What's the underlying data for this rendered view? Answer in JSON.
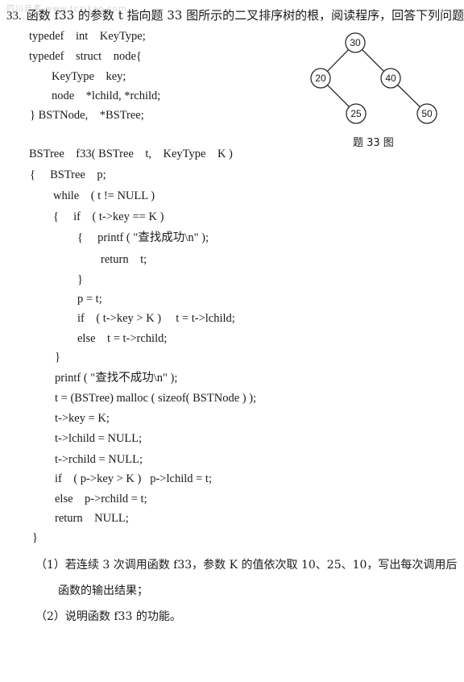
{
  "watermark": "四川自考 www.tczikao.com",
  "question": {
    "number": "33.",
    "prompt": "函数 f33 的参数 t 指向题 33 图所示的二叉排序树的根，阅读程序，回答下列问题。"
  },
  "code": {
    "typedef_lines": [
      "typedef    int    KeyType;",
      "typedef    struct    node{",
      "KeyType    key;",
      "node    *lchild, *rchild;",
      "} BSTNode,    *BSTree;"
    ],
    "function_lines": [
      "BSTree    f33( BSTree    t,    KeyType    K )",
      "{     BSTree    p;",
      "while    ( t != NULL )",
      "{     if    ( t->key == K )",
      "{     printf ( \"查找成功\\n\" );",
      "return    t;",
      "}",
      "p = t;",
      "if    ( t->key > K )     t = t->lchild;",
      "else    t = t->rchild;",
      "}",
      "printf ( \"查找不成功\\n\" );",
      "t = (BSTree) malloc ( sizeof( BSTNode ) );",
      "t->key = K;",
      "t->lchild = NULL;",
      "t->rchild = NULL;",
      "if    ( p->key > K )   p->lchild = t;",
      "else    p->rchild = t;",
      "return    NULL;",
      "}"
    ]
  },
  "figure": {
    "nodes": [
      {
        "id": "n30",
        "label": "30"
      },
      {
        "id": "n20",
        "label": "20"
      },
      {
        "id": "n40",
        "label": "40"
      },
      {
        "id": "n25",
        "label": "25"
      },
      {
        "id": "n50",
        "label": "50"
      }
    ],
    "edges": [
      {
        "from": "n30",
        "to": "n20"
      },
      {
        "from": "n30",
        "to": "n40"
      },
      {
        "from": "n20",
        "to": "n25"
      },
      {
        "from": "n40",
        "to": "n50"
      }
    ],
    "caption": "题 33 图"
  },
  "sub_questions": [
    {
      "label": "（1）",
      "text_line1": "若连续 3 次调用函数 f33，参数 K 的值依次取 10、25、10，写出每次调用后",
      "text_line2": "函数的输出结果；"
    },
    {
      "label": "（2）",
      "text_line1": "说明函数 f33 的功能。"
    }
  ]
}
